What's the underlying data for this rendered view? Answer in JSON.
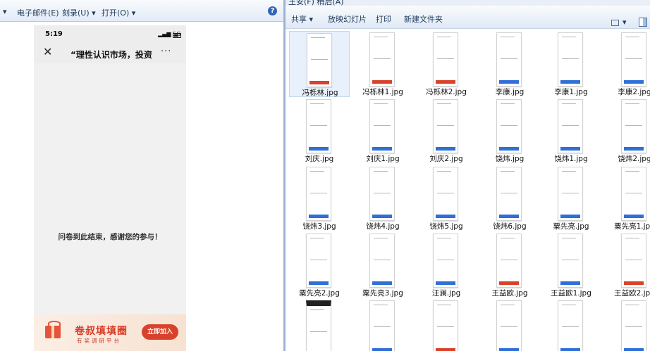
{
  "left_toolbar": {
    "arrow": "▾",
    "email": "电子邮件(E)",
    "burn": "刻录(U) ▾",
    "open": "打开(O) ▾",
    "help": "?"
  },
  "phone": {
    "time": "5:19",
    "signal": "5G",
    "close": "✕",
    "title": "“理性认识市场，投资",
    "more": "···",
    "message": "问卷到此结束，感谢您的参与！",
    "ad_title": "卷叔填填圈",
    "ad_subtitle": "有奖调研平台",
    "ad_button": "立即加入"
  },
  "right_toolbar": {
    "address_text": "王安(F)  稍后(A)",
    "share": "共享 ▾",
    "slideshow": "放映幻灯片",
    "print": "打印",
    "new_folder": "新建文件夹",
    "view_drop": "▾"
  },
  "files": [
    {
      "name": "冯栎林.jpg",
      "bar": "#d9412b",
      "selected": true
    },
    {
      "name": "冯栎林1.jpg",
      "bar": "#d9412b"
    },
    {
      "name": "冯栎林2.jpg",
      "bar": "#d9412b"
    },
    {
      "name": "李康.jpg",
      "bar": "#2f6fd6"
    },
    {
      "name": "李康1.jpg",
      "bar": "#2f6fd6"
    },
    {
      "name": "李康2.jpg",
      "bar": "#2f6fd6"
    },
    {
      "name": "刘庆.jpg",
      "bar": "#2f6fd6"
    },
    {
      "name": "刘庆1.jpg",
      "bar": "#2f6fd6"
    },
    {
      "name": "刘庆2.jpg",
      "bar": "#2f6fd6"
    },
    {
      "name": "饶炜.jpg",
      "bar": "#2f6fd6"
    },
    {
      "name": "饶炜1.jpg",
      "bar": "#2f6fd6"
    },
    {
      "name": "饶炜2.jpg",
      "bar": "#2f6fd6"
    },
    {
      "name": "饶炜3.jpg",
      "bar": "#2f6fd6"
    },
    {
      "name": "饶炜4.jpg",
      "bar": "#2f6fd6"
    },
    {
      "name": "饶炜5.jpg",
      "bar": "#2f6fd6"
    },
    {
      "name": "饶炜6.jpg",
      "bar": "#2f6fd6"
    },
    {
      "name": "粟先亮.jpg",
      "bar": "#2f6fd6"
    },
    {
      "name": "粟先亮1.jpg",
      "bar": "#2f6fd6"
    },
    {
      "name": "粟先亮2.jpg",
      "bar": "#2f6fd6"
    },
    {
      "name": "粟先亮3.jpg",
      "bar": "#2f6fd6"
    },
    {
      "name": "汪澜.jpg",
      "bar": "#2f6fd6"
    },
    {
      "name": "王益欧.jpg",
      "bar": "#d9412b"
    },
    {
      "name": "王益欧1.jpg",
      "bar": "#2f6fd6"
    },
    {
      "name": "王益欧2.jpg",
      "bar": "#d9412b"
    },
    {
      "name": "",
      "bar": "#2f6fd6"
    },
    {
      "name": "",
      "bar": "#2f6fd6"
    },
    {
      "name": "",
      "bar": "#d9412b"
    },
    {
      "name": "",
      "bar": "#2f6fd6"
    },
    {
      "name": "",
      "bar": "#2f6fd6"
    },
    {
      "name": "",
      "bar": "#2f6fd6"
    }
  ]
}
